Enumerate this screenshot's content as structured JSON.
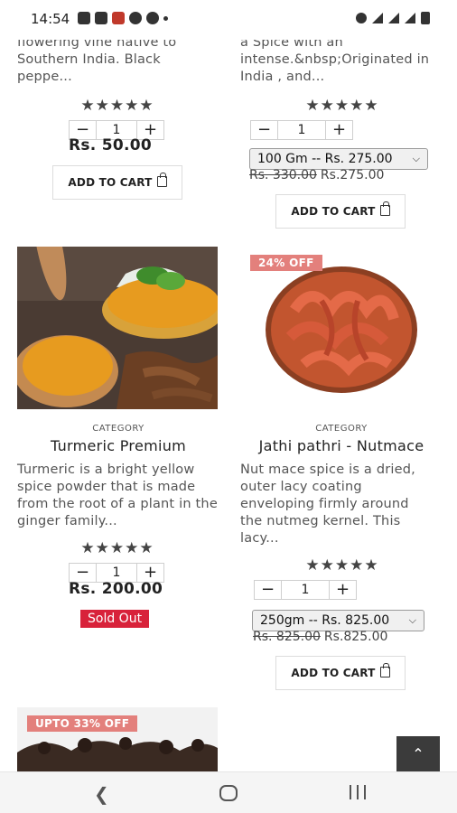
{
  "status_bar": {
    "time": "14:54"
  },
  "top_left": {
    "description_tail": "flowering vine native to Southern India. Black peppe...",
    "stars": "★★★★★",
    "qty_minus": "−",
    "qty_value": "1",
    "qty_plus": "+",
    "price": "Rs. 50.00",
    "add_to_cart": "ADD TO CART"
  },
  "top_right": {
    "description_tail": "a Spice with an intense.&nbsp;Originated in India , and...",
    "stars": "★★★★★",
    "qty_minus": "−",
    "qty_value": "1",
    "qty_plus": "+",
    "variant": "100 Gm -- Rs. 275.00",
    "old_price": "Rs. 330.00",
    "new_price": "Rs.275.00",
    "add_to_cart": "ADD TO CART"
  },
  "product_turmeric": {
    "category": "CATEGORY",
    "name": "Turmeric Premium",
    "description": "Turmeric is a bright yellow spice powder that is made from the root of a plant in the ginger family...",
    "stars": "★★★★★",
    "qty_minus": "−",
    "qty_value": "1",
    "qty_plus": "+",
    "price": "Rs. 200.00",
    "sold_out": "Sold Out"
  },
  "product_nutmace": {
    "badge": "24% OFF",
    "category": "CATEGORY",
    "name": "Jathi pathri - Nutmace",
    "description": "Nut mace spice is a dried, outer lacy coating enveloping firmly around the nutmeg kernel. This lacy...",
    "stars": "★★★★★",
    "qty_minus": "−",
    "qty_value": "1",
    "qty_plus": "+",
    "variant": "250gm -- Rs. 825.00",
    "old_price": "Rs. 825.00",
    "new_price": "Rs.825.00",
    "add_to_cart": "ADD TO CART"
  },
  "product_cloves": {
    "badge": "UPTO 33% OFF"
  },
  "scroll_top_icon": "⌃",
  "colors": {
    "badge": "#e3807c",
    "sold_out": "#d8223a",
    "scroll_top": "#3b3b3b"
  }
}
